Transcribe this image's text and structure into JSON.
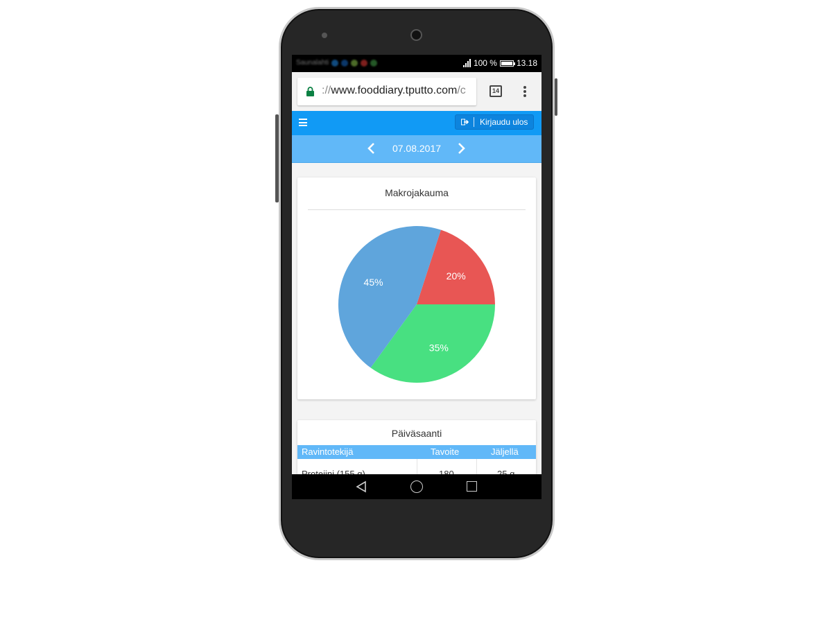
{
  "status_bar": {
    "carrier": "Saunalahti",
    "battery_percent": "100 %",
    "battery_level": 1.0,
    "time": "13.18"
  },
  "browser": {
    "url_scheme": "://",
    "url_host": "www.fooddiary.tputto.com",
    "url_rest": "/c",
    "tab_count": "14"
  },
  "navbar": {
    "logout_label": "Kirjaudu ulos"
  },
  "date_nav": {
    "date": "07.08.2017"
  },
  "macro_card": {
    "title": "Makrojakauma"
  },
  "chart_data": {
    "type": "pie",
    "slices": [
      {
        "label": "20%",
        "value": 20,
        "color": "#e85654"
      },
      {
        "label": "35%",
        "value": 35,
        "color": "#48e081"
      },
      {
        "label": "45%",
        "value": 45,
        "color": "#5fa5dc"
      }
    ]
  },
  "daily_card": {
    "title": "Päiväsaanti",
    "columns": [
      "Ravintotekijä",
      "Tavoite",
      "Jäljellä"
    ],
    "rows": [
      {
        "nutrient": "Proteiini (155 g)",
        "target": "180",
        "remaining": "25 g"
      }
    ]
  },
  "colors": {
    "navbar": "#119af5",
    "datebar": "#61b8f8"
  }
}
